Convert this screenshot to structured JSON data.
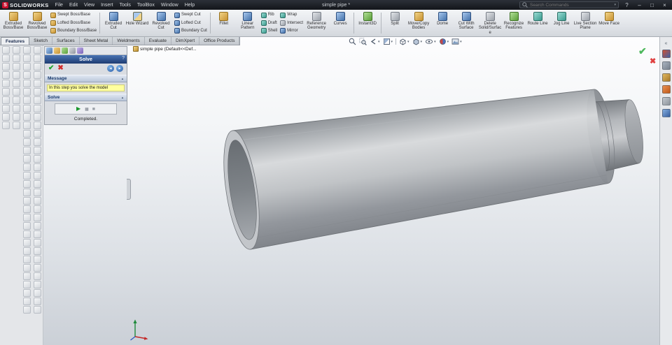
{
  "titlebar": {
    "logo_letter": "S",
    "logo_text": "SOLIDWORKS",
    "menus": [
      "File",
      "Edit",
      "View",
      "Insert",
      "Tools",
      "ToolBox",
      "Window",
      "Help"
    ],
    "document_title": "simple pipe *",
    "search_placeholder": "Search Commands",
    "help_button": "?",
    "minimize": "–",
    "restore": "□",
    "close": "×"
  },
  "ribbon": {
    "items": [
      {
        "label": "Extruded Boss/Base"
      },
      {
        "label": "Revolved Boss/Base"
      },
      {
        "labels": [
          "Swept Boss/Base",
          "Lofted Boss/Base",
          "Boundary Boss/Base"
        ]
      },
      {
        "label": "Extruded Cut"
      },
      {
        "label": "Hole Wizard"
      },
      {
        "label": "Revolved Cut"
      },
      {
        "labels": [
          "Swept Cut",
          "Lofted Cut",
          "Boundary Cut"
        ]
      },
      {
        "label": "Fillet"
      },
      {
        "label": "Linear Pattern"
      },
      {
        "labels": [
          "Rib",
          "Draft",
          "Shell"
        ]
      },
      {
        "labels": [
          "Wrap",
          "Intersect",
          "Mirror"
        ]
      },
      {
        "label": "Reference Geometry"
      },
      {
        "label": "Curves"
      },
      {
        "label": "Instant3D"
      },
      {
        "label": "Split"
      },
      {
        "label": "Move/Copy Bodies"
      },
      {
        "label": "Dome"
      },
      {
        "label": "Cut With Surface"
      },
      {
        "label": "Delete Solid/Surface"
      },
      {
        "label": "Recognize Features"
      },
      {
        "label": "Route Line"
      },
      {
        "label": "Jog Line"
      },
      {
        "label": "Live Section Plane"
      },
      {
        "label": "Move Face"
      }
    ]
  },
  "tabs": [
    {
      "label": "Features"
    },
    {
      "label": "Sketch"
    },
    {
      "label": "Surfaces"
    },
    {
      "label": "Sheet Metal"
    },
    {
      "label": "Weldments"
    },
    {
      "label": "Evaluate"
    },
    {
      "label": "DimXpert"
    },
    {
      "label": "Office Products"
    }
  ],
  "property_panel": {
    "title": "Solve",
    "help": "?",
    "message_header": "Message",
    "message_text": "In this step you solve the model",
    "solve_header": "Solve",
    "status": "Completed."
  },
  "viewport": {
    "tree_root": "simple pipe (Default<<Def..."
  },
  "left_rail": {
    "column_counts": [
      10,
      10,
      32,
      32
    ]
  }
}
